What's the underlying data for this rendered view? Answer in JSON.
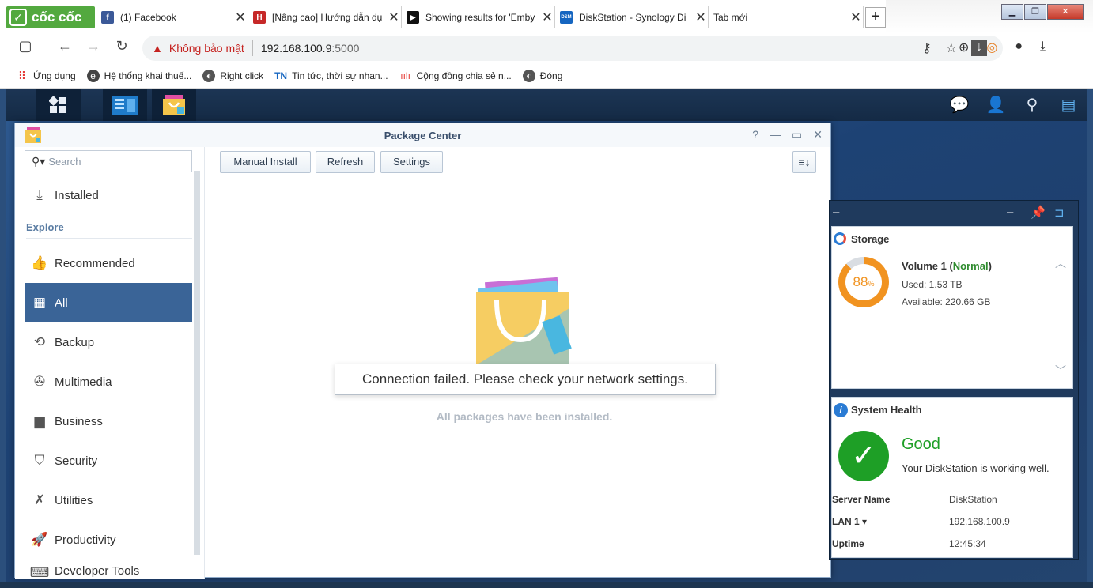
{
  "browser": {
    "brand": "cốc cốc",
    "tabs": [
      {
        "title": "(1) Facebook",
        "favicon_color": "#3b5998",
        "favicon_glyph": "f"
      },
      {
        "title": "[Nâng cao] Hướng dẫn dụ",
        "favicon_color": "#c62828",
        "favicon_glyph": "H"
      },
      {
        "title": "Showing results for 'Emby",
        "favicon_color": "#111111",
        "favicon_glyph": "▶"
      },
      {
        "title": "DiskStation - Synology Di",
        "favicon_color": "#1565c0",
        "favicon_glyph": "DSM"
      },
      {
        "title": "Tab mới",
        "favicon_color": "#ffffff",
        "favicon_glyph": ""
      }
    ],
    "new_tab": "+",
    "address": {
      "warning": "Không bảo mật",
      "host": "192.168.100.9",
      "port": ":5000"
    },
    "bookmarks": [
      {
        "label": "Ứng dụng",
        "icon": "apps-icon"
      },
      {
        "label": "Hệ thống khai thuế...",
        "icon": "e-icon"
      },
      {
        "label": "Right click",
        "icon": "globe-icon"
      },
      {
        "label": "Tin tức, thời sự nhan...",
        "icon": "tn-icon"
      },
      {
        "label": "Cộng đồng chia sẻ n...",
        "icon": "equalizer-icon"
      },
      {
        "label": "Đóng",
        "icon": "globe-icon"
      }
    ]
  },
  "package_center": {
    "title": "Package Center",
    "search_placeholder": "Search",
    "installed": "Installed",
    "explore": "Explore",
    "nav": [
      {
        "label": "Recommended",
        "icon": "thumbs-up-icon"
      },
      {
        "label": "All",
        "icon": "grid-icon"
      },
      {
        "label": "Backup",
        "icon": "backup-icon"
      },
      {
        "label": "Multimedia",
        "icon": "film-reel-icon"
      },
      {
        "label": "Business",
        "icon": "briefcase-icon"
      },
      {
        "label": "Security",
        "icon": "shield-icon"
      },
      {
        "label": "Utilities",
        "icon": "wrench-icon"
      },
      {
        "label": "Productivity",
        "icon": "rocket-icon"
      },
      {
        "label": "Developer Tools",
        "icon": "code-icon"
      }
    ],
    "toolbar": {
      "manual_install": "Manual Install",
      "refresh": "Refresh",
      "settings": "Settings"
    },
    "empty_message": "All packages have been installed.",
    "toast": "Connection failed. Please check your network settings."
  },
  "widgets": {
    "storage": {
      "title": "Storage",
      "percent": "88",
      "percent_unit": "%",
      "volume": "Volume 1",
      "status": "Normal",
      "used": "Used: 1.53 TB",
      "available": "Available: 220.66 GB"
    },
    "health": {
      "title": "System Health",
      "status": "Good",
      "message": "Your DiskStation is working well.",
      "rows": [
        {
          "key": "Server Name",
          "value": "DiskStation"
        },
        {
          "key": "LAN 1",
          "value": "192.168.100.9"
        },
        {
          "key": "Uptime",
          "value": "12:45:34"
        }
      ]
    }
  },
  "colors": {
    "accent": "#3a6497",
    "storage_orange": "#f19320",
    "good_green": "#1e9f26"
  }
}
